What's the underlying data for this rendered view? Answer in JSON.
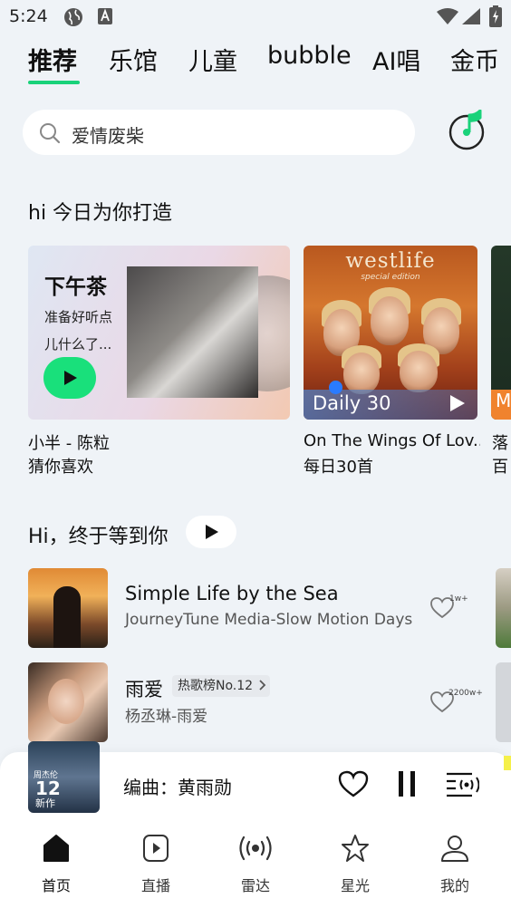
{
  "status_bar": {
    "time": "5:24"
  },
  "tabs": [
    {
      "label": "推荐",
      "active": true
    },
    {
      "label": "乐馆",
      "active": false
    },
    {
      "label": "儿童",
      "active": false
    },
    {
      "label": "bubble",
      "active": false
    },
    {
      "label": "AI唱",
      "active": false
    },
    {
      "label": "金币",
      "active": false
    }
  ],
  "search": {
    "placeholder": "爱情废柴"
  },
  "section_today": {
    "title": "hi 今日为你打造"
  },
  "cards": [
    {
      "heading": "下午茶",
      "line1": "准备好听点",
      "line2": "儿什么了...",
      "caption": "小半 - 陈粒",
      "subcaption": "猜你喜欢"
    },
    {
      "brand": "westlife",
      "edition": "special edition",
      "badge": "Daily 30",
      "caption": "On The Wings Of Lov...",
      "subcaption": "每日30首"
    },
    {
      "badge": "M",
      "caption": "落",
      "subcaption": "百"
    }
  ],
  "section_hi": {
    "title": "Hi，终于等到你"
  },
  "songs": [
    {
      "title": "Simple Life by the Sea",
      "subtitle": "JourneyTune Media-Slow Motion Days",
      "likes": "1w+"
    },
    {
      "title": "雨爱",
      "rank": "热歌榜No.12",
      "subtitle": "杨丞琳-雨爱",
      "likes": "2200w+"
    }
  ],
  "mini_player": {
    "text": "编曲：黄雨勋",
    "cover_small": "周杰伦",
    "cover_big": "12",
    "cover_tag": "新作"
  },
  "bottom_nav": [
    {
      "label": "首页",
      "icon": "home-icon",
      "active": true
    },
    {
      "label": "直播",
      "icon": "live-play-icon",
      "active": false
    },
    {
      "label": "雷达",
      "icon": "radar-icon",
      "active": false
    },
    {
      "label": "星光",
      "icon": "star-icon",
      "active": false
    },
    {
      "label": "我的",
      "icon": "profile-icon",
      "active": false
    }
  ],
  "colors": {
    "accent_green": "#19d27a",
    "background": "#eff3f7"
  }
}
